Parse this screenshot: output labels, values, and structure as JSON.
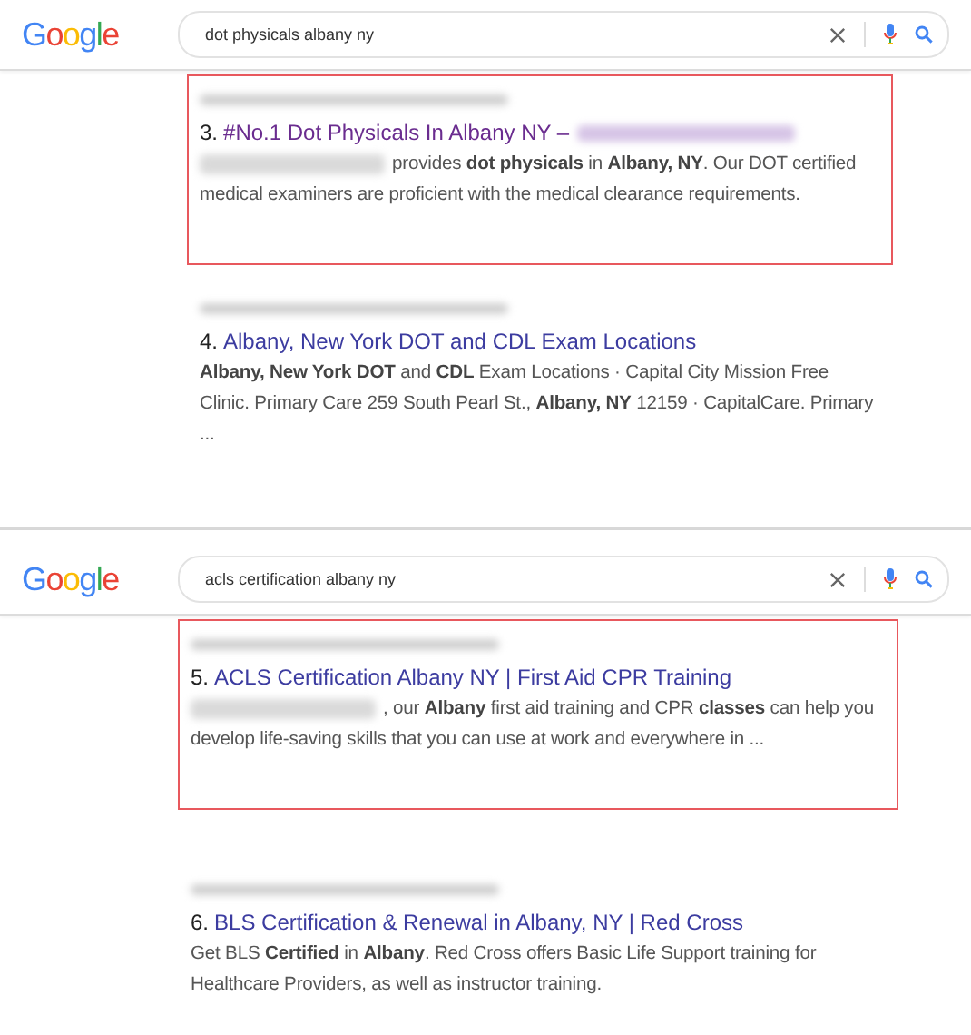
{
  "panels": [
    {
      "logo": "Google",
      "search": {
        "value": "dot physicals albany ny"
      },
      "results": [
        {
          "number": "3.",
          "title": "#No.1 Dot Physicals In Albany NY –",
          "title_redacted": true,
          "visited": true,
          "snippet_redacted": true,
          "snippet": "provides **dot physicals** in **Albany, NY**. Our DOT certified medical examiners are proficient with the medical clearance requirements.",
          "highlighted": true
        },
        {
          "number": "4.",
          "title": "Albany, New York DOT and CDL Exam Locations",
          "title_redacted": false,
          "visited": false,
          "snippet_redacted": false,
          "snippet": "**Albany, New York DOT** and **CDL** Exam Locations · Capital City Mission Free Clinic. Primary Care 259 South Pearl St., **Albany, NY** 12159 · CapitalCare. Primary ...",
          "highlighted": false
        }
      ]
    },
    {
      "logo": "Google",
      "search": {
        "value": "acls certification albany ny"
      },
      "results": [
        {
          "number": "5.",
          "title": "ACLS Certification Albany NY | First Aid CPR Training",
          "title_redacted": false,
          "visited": false,
          "snippet_redacted": true,
          "snippet": ", our **Albany** first aid training and CPR **classes** can help you develop life-saving skills that you can use at work and everywhere in ...",
          "highlighted": true
        },
        {
          "number": "6.",
          "title": "BLS Certification & Renewal in Albany, NY | Red Cross",
          "title_redacted": false,
          "visited": false,
          "snippet_redacted": false,
          "snippet": "Get BLS **Certified** in **Albany**. Red Cross offers Basic Life Support training for Healthcare Providers, as well as instructor training.",
          "highlighted": false
        }
      ]
    }
  ]
}
